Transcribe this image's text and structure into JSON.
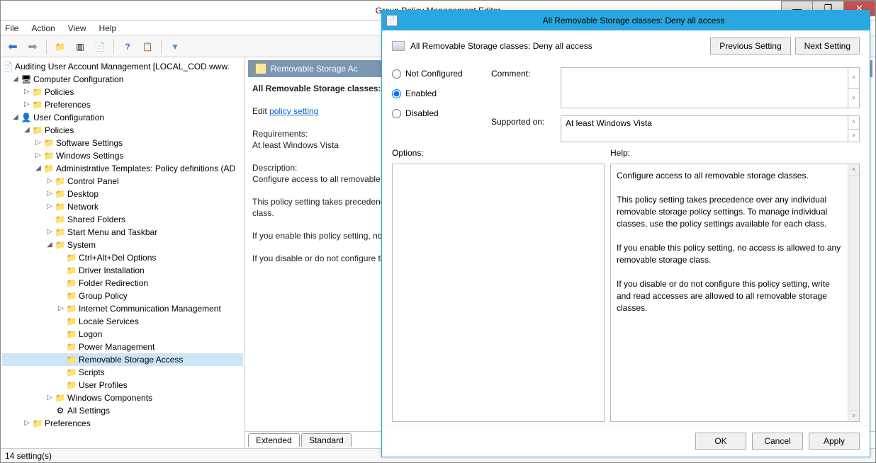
{
  "main": {
    "title": "Group Policy Management Editor",
    "menus": [
      "File",
      "Action",
      "View",
      "Help"
    ],
    "status": "14 setting(s)"
  },
  "tree": {
    "root": "Auditing User Account Management [LOCAL_COD.www.",
    "computer_config": "Computer Configuration",
    "cc_policies": "Policies",
    "cc_preferences": "Preferences",
    "user_config": "User Configuration",
    "uc_policies": "Policies",
    "software_settings": "Software Settings",
    "windows_settings": "Windows Settings",
    "admin_templates": "Administrative Templates: Policy definitions (AD",
    "control_panel": "Control Panel",
    "desktop": "Desktop",
    "network": "Network",
    "shared_folders": "Shared Folders",
    "start_menu": "Start Menu and Taskbar",
    "system": "System",
    "ctrl_alt_del": "Ctrl+Alt+Del Options",
    "driver_install": "Driver Installation",
    "folder_redir": "Folder Redirection",
    "group_policy": "Group Policy",
    "icm": "Internet Communication Management",
    "locale": "Locale Services",
    "logon": "Logon",
    "power": "Power Management",
    "removable": "Removable Storage Access",
    "scripts": "Scripts",
    "user_profiles": "User Profiles",
    "win_components": "Windows Components",
    "all_settings": "All Settings",
    "uc_preferences": "Preferences"
  },
  "detail": {
    "header": "Removable Storage Ac",
    "setting_title": "All Removable Storage classes: Deny all access",
    "edit_label": "Edit",
    "edit_link": "policy setting",
    "req_label": "Requirements:",
    "req_value": "At least Windows Vista",
    "desc_label": "Description:",
    "desc_p1": "Configure access to all removable storage classes.",
    "desc_p2": "This policy setting takes precedence over any individual removable storage policy settings. To manage individual classes, use the policy settings available for each class.",
    "desc_p3": "If you enable this policy setting, no access is allowed to any removable storage class.",
    "desc_p4": "If you disable or do not configure this policy setting, write and read accesses are allowed to all removable storage classes.",
    "tab_extended": "Extended",
    "tab_standard": "Standard"
  },
  "dialog": {
    "title": "All Removable Storage classes: Deny all access",
    "setting_name": "All Removable Storage classes: Deny all access",
    "prev": "Previous Setting",
    "next": "Next Setting",
    "not_configured": "Not Configured",
    "enabled": "Enabled",
    "disabled": "Disabled",
    "comment_label": "Comment:",
    "supported_label": "Supported on:",
    "supported_value": "At least Windows Vista",
    "options_label": "Options:",
    "help_label": "Help:",
    "help_p1": "Configure access to all removable storage classes.",
    "help_p2": "This policy setting takes precedence over any individual removable storage policy settings. To manage individual classes, use the policy settings available for each class.",
    "help_p3": "If you enable this policy setting, no access is allowed to any removable storage class.",
    "help_p4": "If you disable or do not configure this policy setting, write and read accesses are allowed to all removable storage classes.",
    "ok": "OK",
    "cancel": "Cancel",
    "apply": "Apply"
  }
}
